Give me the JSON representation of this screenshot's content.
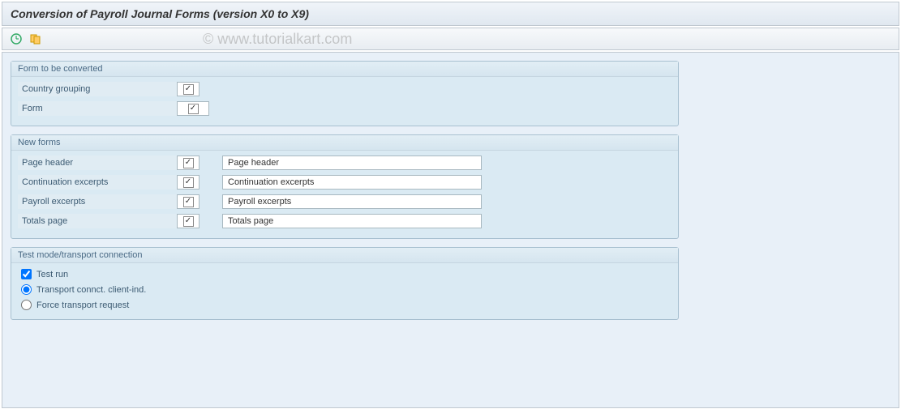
{
  "header": {
    "title": "Conversion of Payroll Journal Forms (version X0 to X9)"
  },
  "watermark": "© www.tutorialkart.com",
  "groups": {
    "form_to_convert": {
      "title": "Form to be converted",
      "fields": {
        "country_grouping": {
          "label": "Country grouping"
        },
        "form": {
          "label": "Form"
        }
      }
    },
    "new_forms": {
      "title": "New forms",
      "fields": {
        "page_header": {
          "label": "Page header",
          "value": "Page header"
        },
        "continuation_excerpts": {
          "label": "Continuation excerpts",
          "value": "Continuation excerpts"
        },
        "payroll_excerpts": {
          "label": "Payroll excerpts",
          "value": "Payroll excerpts"
        },
        "totals_page": {
          "label": "Totals page",
          "value": "Totals page"
        }
      }
    },
    "test_mode": {
      "title": "Test mode/transport connection",
      "test_run": "Test run",
      "transport_client": "Transport connct. client-ind.",
      "force_transport": "Force transport request"
    }
  }
}
